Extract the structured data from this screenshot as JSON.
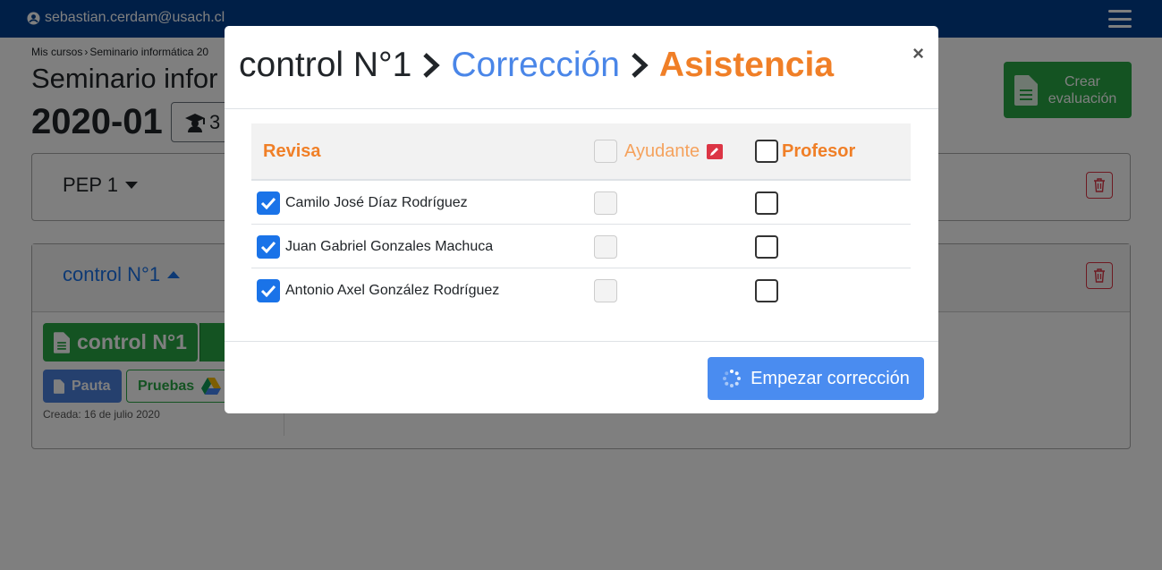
{
  "topbar": {
    "email": "sebastian.cerdam@usach.cl"
  },
  "breadcrumb": {
    "mis_cursos": "Mis cursos",
    "curso": "Seminario informática 20"
  },
  "course": {
    "title": "Seminario infor",
    "semester": "2020-01",
    "students": "3"
  },
  "crear_evaluacion": "Crear evaluación",
  "pep": {
    "title": "PEP 1"
  },
  "control": {
    "title": "control N°1",
    "eval_button": "control N°1",
    "pauta": "Pauta",
    "pruebas": "Pruebas",
    "created": "Creada: 16 de julio 2020"
  },
  "modal": {
    "title_part1": "control N°1",
    "title_part2": "Corrección",
    "title_part3": "Asistencia",
    "close": "×",
    "headers": {
      "revisa": "Revisa",
      "ayudante": "Ayudante",
      "profesor": "Profesor"
    },
    "rows": [
      {
        "name": "Camilo José Díaz Rodríguez",
        "revisa": true,
        "ayudante": false,
        "profesor": false
      },
      {
        "name": "Juan Gabriel Gonzales Machuca",
        "revisa": true,
        "ayudante": false,
        "profesor": false
      },
      {
        "name": "Antonio Axel González Rodríguez",
        "revisa": true,
        "ayudante": false,
        "profesor": false
      }
    ],
    "submit": "Empezar corrección"
  },
  "colors": {
    "navbar": "#003f8f",
    "accent_orange": "#f07f27",
    "link_blue": "#4a86e8",
    "success": "#28a745",
    "danger": "#dc3545"
  },
  "icons": [
    "user-circle-icon",
    "hamburger-icon",
    "graduate-icon",
    "document-icon",
    "trash-icon",
    "copy-icon",
    "google-drive-icon",
    "edit-icon",
    "chevron-right-icon",
    "spinner-icon",
    "check-icon"
  ]
}
